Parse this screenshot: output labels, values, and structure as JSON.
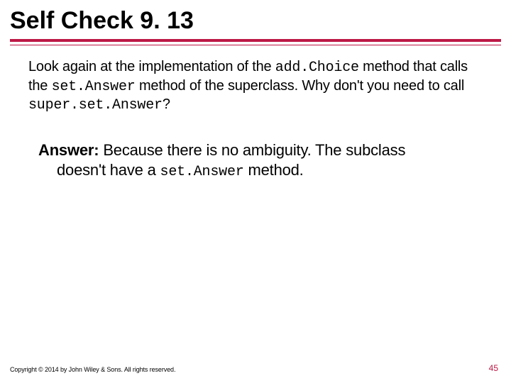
{
  "title": "Self Check 9. 13",
  "question": {
    "pre1": "Look again at the implementation of the ",
    "code1": "add.Choice",
    "post1": " method that calls the ",
    "code2": "set.Answer",
    "post2": " method of the superclass. Why don't you need to call ",
    "code3": "super.set.Answer",
    "post3": "?"
  },
  "answer": {
    "label": "Answer:",
    "line1": " Because there is no ambiguity. The subclass",
    "line2_pre": "doesn't have a ",
    "line2_code": "set.Answer",
    "line2_post": " method."
  },
  "footer": "Copyright © 2014 by John Wiley & Sons. All rights reserved.",
  "page": "45"
}
